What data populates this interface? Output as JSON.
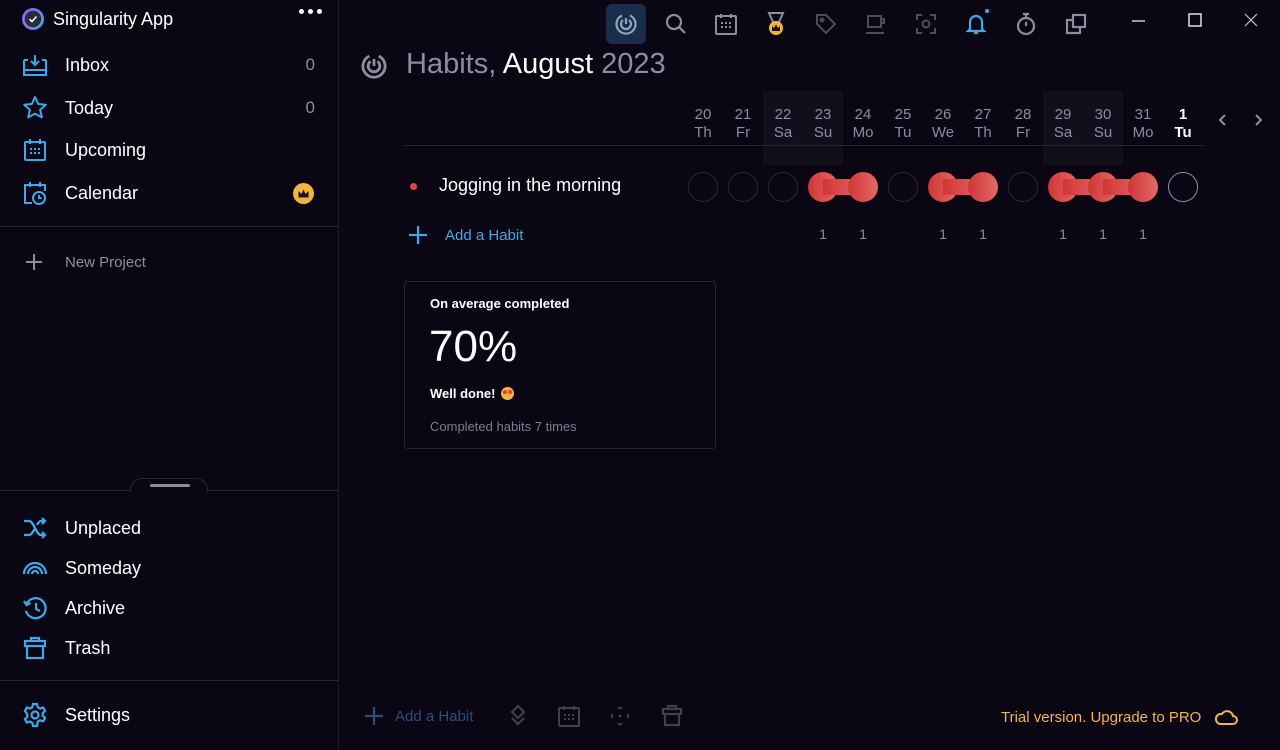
{
  "app": {
    "title": "Singularity App"
  },
  "sidebar": {
    "top_items": [
      {
        "label": "Inbox",
        "count": "0",
        "icon": "inbox-icon"
      },
      {
        "label": "Today",
        "count": "0",
        "icon": "star-icon"
      },
      {
        "label": "Upcoming",
        "count": "",
        "icon": "calendar-grid-icon"
      },
      {
        "label": "Calendar",
        "count": "",
        "icon": "calendar-clock-icon",
        "badge": "crown-icon"
      }
    ],
    "new_project_label": "New Project",
    "bottom_items": [
      {
        "label": "Unplaced",
        "icon": "shuffle-icon"
      },
      {
        "label": "Someday",
        "icon": "rainbow-icon"
      },
      {
        "label": "Archive",
        "icon": "history-icon"
      },
      {
        "label": "Trash",
        "icon": "trash-icon"
      }
    ],
    "settings_label": "Settings"
  },
  "toolbar": {
    "icons": [
      "habits-icon",
      "search-icon",
      "calendar-icon",
      "medal-crown-icon",
      "tag-icon",
      "coffee-icon",
      "focus-icon",
      "bell-icon",
      "stopwatch-icon",
      "copy-icon"
    ],
    "active": "habits-icon"
  },
  "window_controls": [
    "minimize-icon",
    "maximize-icon",
    "close-icon"
  ],
  "page": {
    "title_prefix": "Habits,",
    "title_month": "August",
    "title_year": "2023"
  },
  "days": [
    {
      "num": "20",
      "dow": "Th"
    },
    {
      "num": "21",
      "dow": "Fr"
    },
    {
      "num": "22",
      "dow": "Sa"
    },
    {
      "num": "23",
      "dow": "Su"
    },
    {
      "num": "24",
      "dow": "Mo"
    },
    {
      "num": "25",
      "dow": "Tu"
    },
    {
      "num": "26",
      "dow": "We"
    },
    {
      "num": "27",
      "dow": "Th"
    },
    {
      "num": "28",
      "dow": "Fr"
    },
    {
      "num": "29",
      "dow": "Sa"
    },
    {
      "num": "30",
      "dow": "Su"
    },
    {
      "num": "31",
      "dow": "Mo"
    },
    {
      "num": "1",
      "dow": "Tu"
    }
  ],
  "habits": [
    {
      "name": "Jogging in the morning",
      "color": "#e04848",
      "completed": [
        false,
        false,
        false,
        true,
        true,
        false,
        true,
        true,
        false,
        true,
        true,
        true,
        false
      ]
    }
  ],
  "counts": [
    "",
    "",
    "",
    "1",
    "1",
    "",
    "1",
    "1",
    "",
    "1",
    "1",
    "1",
    ""
  ],
  "add_habit_label": "Add a Habit",
  "stats": {
    "title": "On average completed",
    "value": "70%",
    "praise": "Well done!",
    "subtitle": "Completed habits 7 times"
  },
  "bottom_bar": {
    "add_label": "Add a Habit",
    "trial_text": "Trial version. Upgrade to PRO"
  },
  "colors": {
    "accent": "#3fa9e8",
    "habit": "#e04848",
    "gold": "#f3b43c",
    "background": "#0a0614"
  }
}
